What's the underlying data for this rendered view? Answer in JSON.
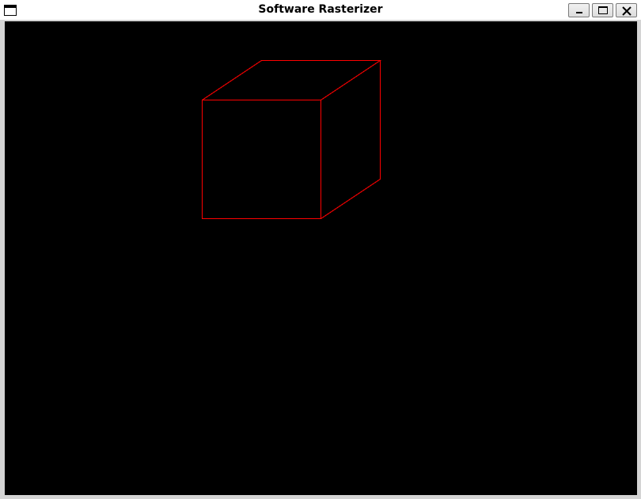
{
  "window": {
    "title": "Software Rasterizer",
    "icon": "window-icon",
    "controls": {
      "minimize_icon": "minimize-icon",
      "maximize_icon": "maximize-icon",
      "close_icon": "close-icon"
    }
  },
  "viewport": {
    "background_color": "#000000",
    "wireframe_color": "#ff0000",
    "object": "cube"
  }
}
